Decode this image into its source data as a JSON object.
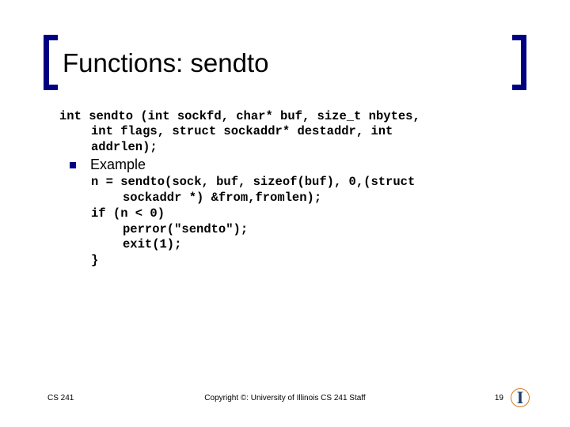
{
  "title": "Functions: sendto",
  "signature": {
    "line1": "int sendto (int sockfd, char* buf, size_t nbytes,",
    "line2": "int flags, struct sockaddr* destaddr, int",
    "line3": "addrlen);"
  },
  "bullet": "Example",
  "code": {
    "l1": "n = sendto(sock, buf, sizeof(buf), 0,(struct",
    "l2": "sockaddr *) &from,fromlen);",
    "l3": "if (n < 0)",
    "l4": "perror(\"sendto\");",
    "l5": "exit(1);",
    "l6": "}"
  },
  "footer": {
    "left": "CS 241",
    "center": "Copyright ©: University of Illinois CS 241 Staff",
    "page": "19"
  }
}
